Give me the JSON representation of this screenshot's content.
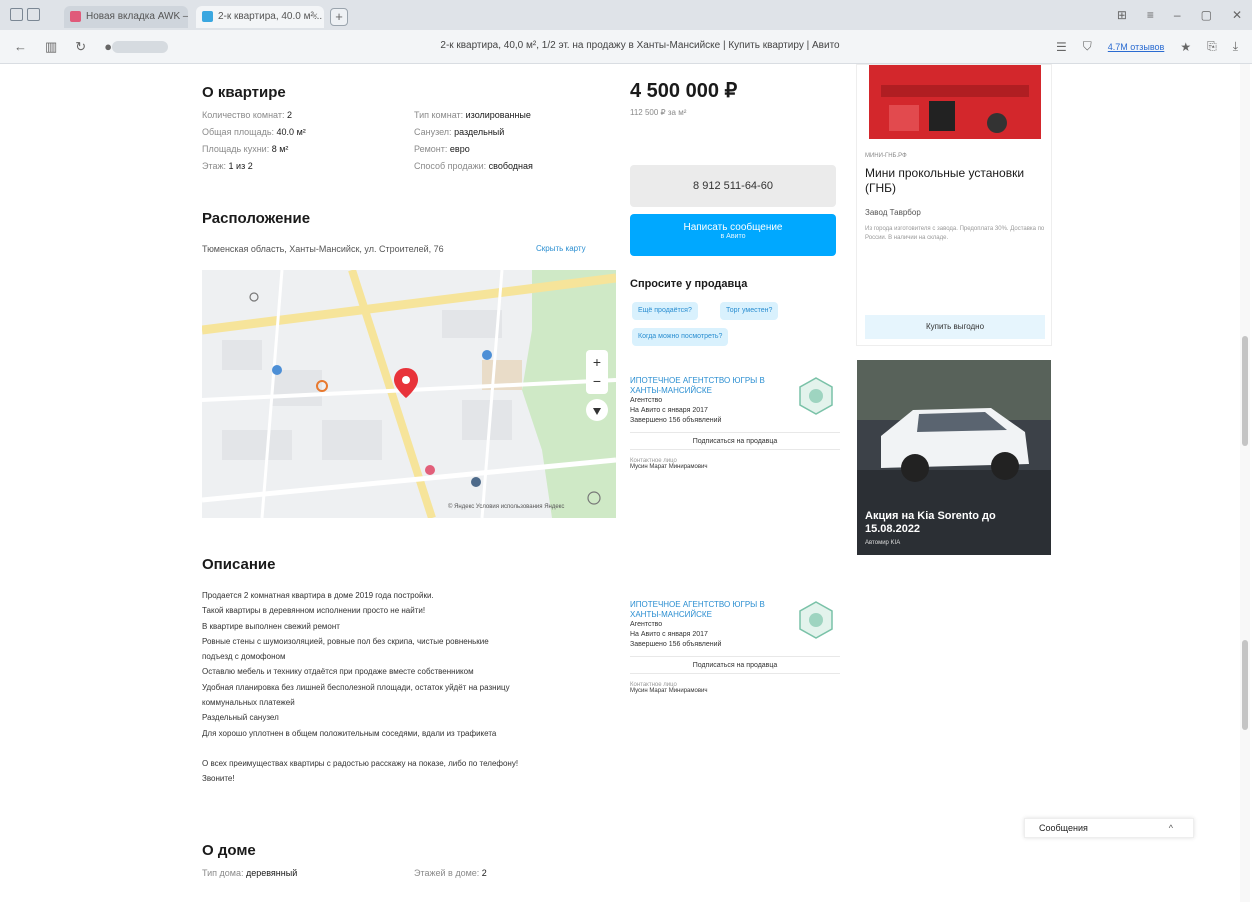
{
  "browser": {
    "tab_inactive": "Новая вкладка AWK — Яндекс",
    "tab_active": "2-к квартира, 40.0 м²...",
    "new_tab": "+",
    "page_title": "2-к квартира, 40,0 м², 1/2 эт. на продажу в Ханты-Мансийске | Купить квартиру | Авито",
    "right_link": "4.7М отзывов"
  },
  "about": {
    "title": "О квартире",
    "left": [
      {
        "label": "Количество комнат:",
        "value": "2"
      },
      {
        "label": "Общая площадь:",
        "value": "40.0 м²"
      },
      {
        "label": "Площадь кухни:",
        "value": "8 м²"
      },
      {
        "label": "Этаж:",
        "value": "1 из 2"
      }
    ],
    "right": [
      {
        "label": "Тип комнат:",
        "value": "изолированные"
      },
      {
        "label": "Санузел:",
        "value": "раздельный"
      },
      {
        "label": "Ремонт:",
        "value": "евро"
      },
      {
        "label": "Способ продажи:",
        "value": "свободная"
      }
    ]
  },
  "sidebar": {
    "price": "4 500 000 ₽",
    "price_per_m": "112 500 ₽ за м²",
    "phone": "8 912 511-64-60",
    "message_label": "Написать сообщение",
    "message_sub": "в Авито",
    "ask_title": "Спросите у продавца",
    "chips": [
      "Ещё продаётся?",
      "Торг уместен?",
      "Когда можно посмотреть?"
    ]
  },
  "location": {
    "title": "Расположение",
    "address": "Тюменская область, Ханты-Мансийск, ул. Строителей, 76",
    "show_map": "Скрыть карту",
    "map_copyright": "© Яндекс  Условия использования  Яндекс"
  },
  "agency": {
    "name": "ИПОТЕЧНОЕ АГЕНТСТВО ЮГРЫ В ХАНТЫ-МАНСИЙСКЕ",
    "type": "Агентство",
    "since": "На Авито с января 2017",
    "completed": "Завершено 156 объявлений",
    "subscribe": "Подписаться на продавца",
    "contact_label": "Контактное лицо",
    "contact_name": "Мусин Марат Минирамович"
  },
  "description": {
    "title": "Описание",
    "lines": [
      "Продается 2 комнатная квартира в доме 2019 года постройки.",
      "Такой квартиры в деревянном исполнении просто не найти!",
      "В квартире выполнен свежий ремонт",
      "Ровные стены с шумоизоляцией, ровные пол без скрипа, чистые ровненькие",
      "подъезд с домофоном",
      "Оставлю мебель и технику отдаётся при продаже вместе собственником",
      "Удобная планировка без лишней бесполезной площади, остаток уйдёт на разницу",
      "коммунальных платежей",
      "Раздельный санузел",
      "Для хорошо уплотнен в общем положительным соседями, вдали из трафикета",
      "",
      "О всех преимуществах квартиры с радостью расскажу на показе, либо по телефону!",
      "Звоните!"
    ]
  },
  "house": {
    "title": "О доме",
    "type_label": "Тип дома:",
    "type_value": "деревянный",
    "floors_label": "Этажей в доме:",
    "floors_value": "2"
  },
  "ad1": {
    "source": "МИНИ-ГНБ.РФ",
    "title": "Мини прокольные установки (ГНБ)",
    "company": "Завод Таврбор",
    "text": "Из города изготовителя с завода. Предоплата 30%. Доставка по России. В наличии на складе.",
    "button": "Купить выгодно"
  },
  "ad2": {
    "headline": "Акция на Kia Sorento до 15.08.2022",
    "small": "Автомир KIA"
  },
  "chat": {
    "label": "Сообщения",
    "chevron": "^"
  },
  "colors": {
    "accent": "#00a8ff",
    "link": "#2a8ed1",
    "pin": "#e8333a"
  }
}
